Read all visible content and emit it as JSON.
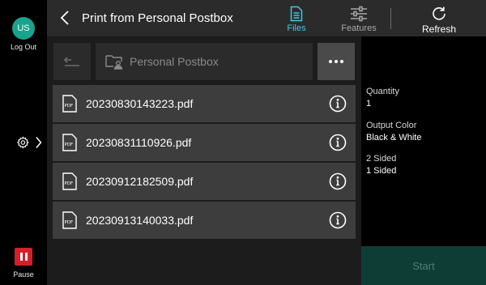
{
  "rail": {
    "avatar_initials": "US",
    "logout_label": "Log Out",
    "settings_icon": "gear-icon",
    "pause_label": "Pause",
    "pause_color": "#d3202a",
    "avatar_color": "#18a38c"
  },
  "header": {
    "title": "Print from Personal Postbox",
    "files_label": "Files",
    "features_label": "Features",
    "refresh_label": "Refresh",
    "active_color": "#3fc7e6"
  },
  "browser": {
    "path": "Personal Postbox",
    "files": [
      {
        "name": "20230830143223.pdf",
        "icon": "pdf-file-icon"
      },
      {
        "name": "20230831110926.pdf",
        "icon": "pdf-file-icon"
      },
      {
        "name": "20230912182509.pdf",
        "icon": "pdf-file-icon"
      },
      {
        "name": "20230913140033.pdf",
        "icon": "pdf-file-icon"
      }
    ]
  },
  "settings": {
    "quantity_label": "Quantity",
    "quantity_value": "1",
    "color_label": "Output Color",
    "color_value": "Black & White",
    "sided_label": "2 Sided",
    "sided_value": "1 Sided"
  },
  "start_label": "Start"
}
